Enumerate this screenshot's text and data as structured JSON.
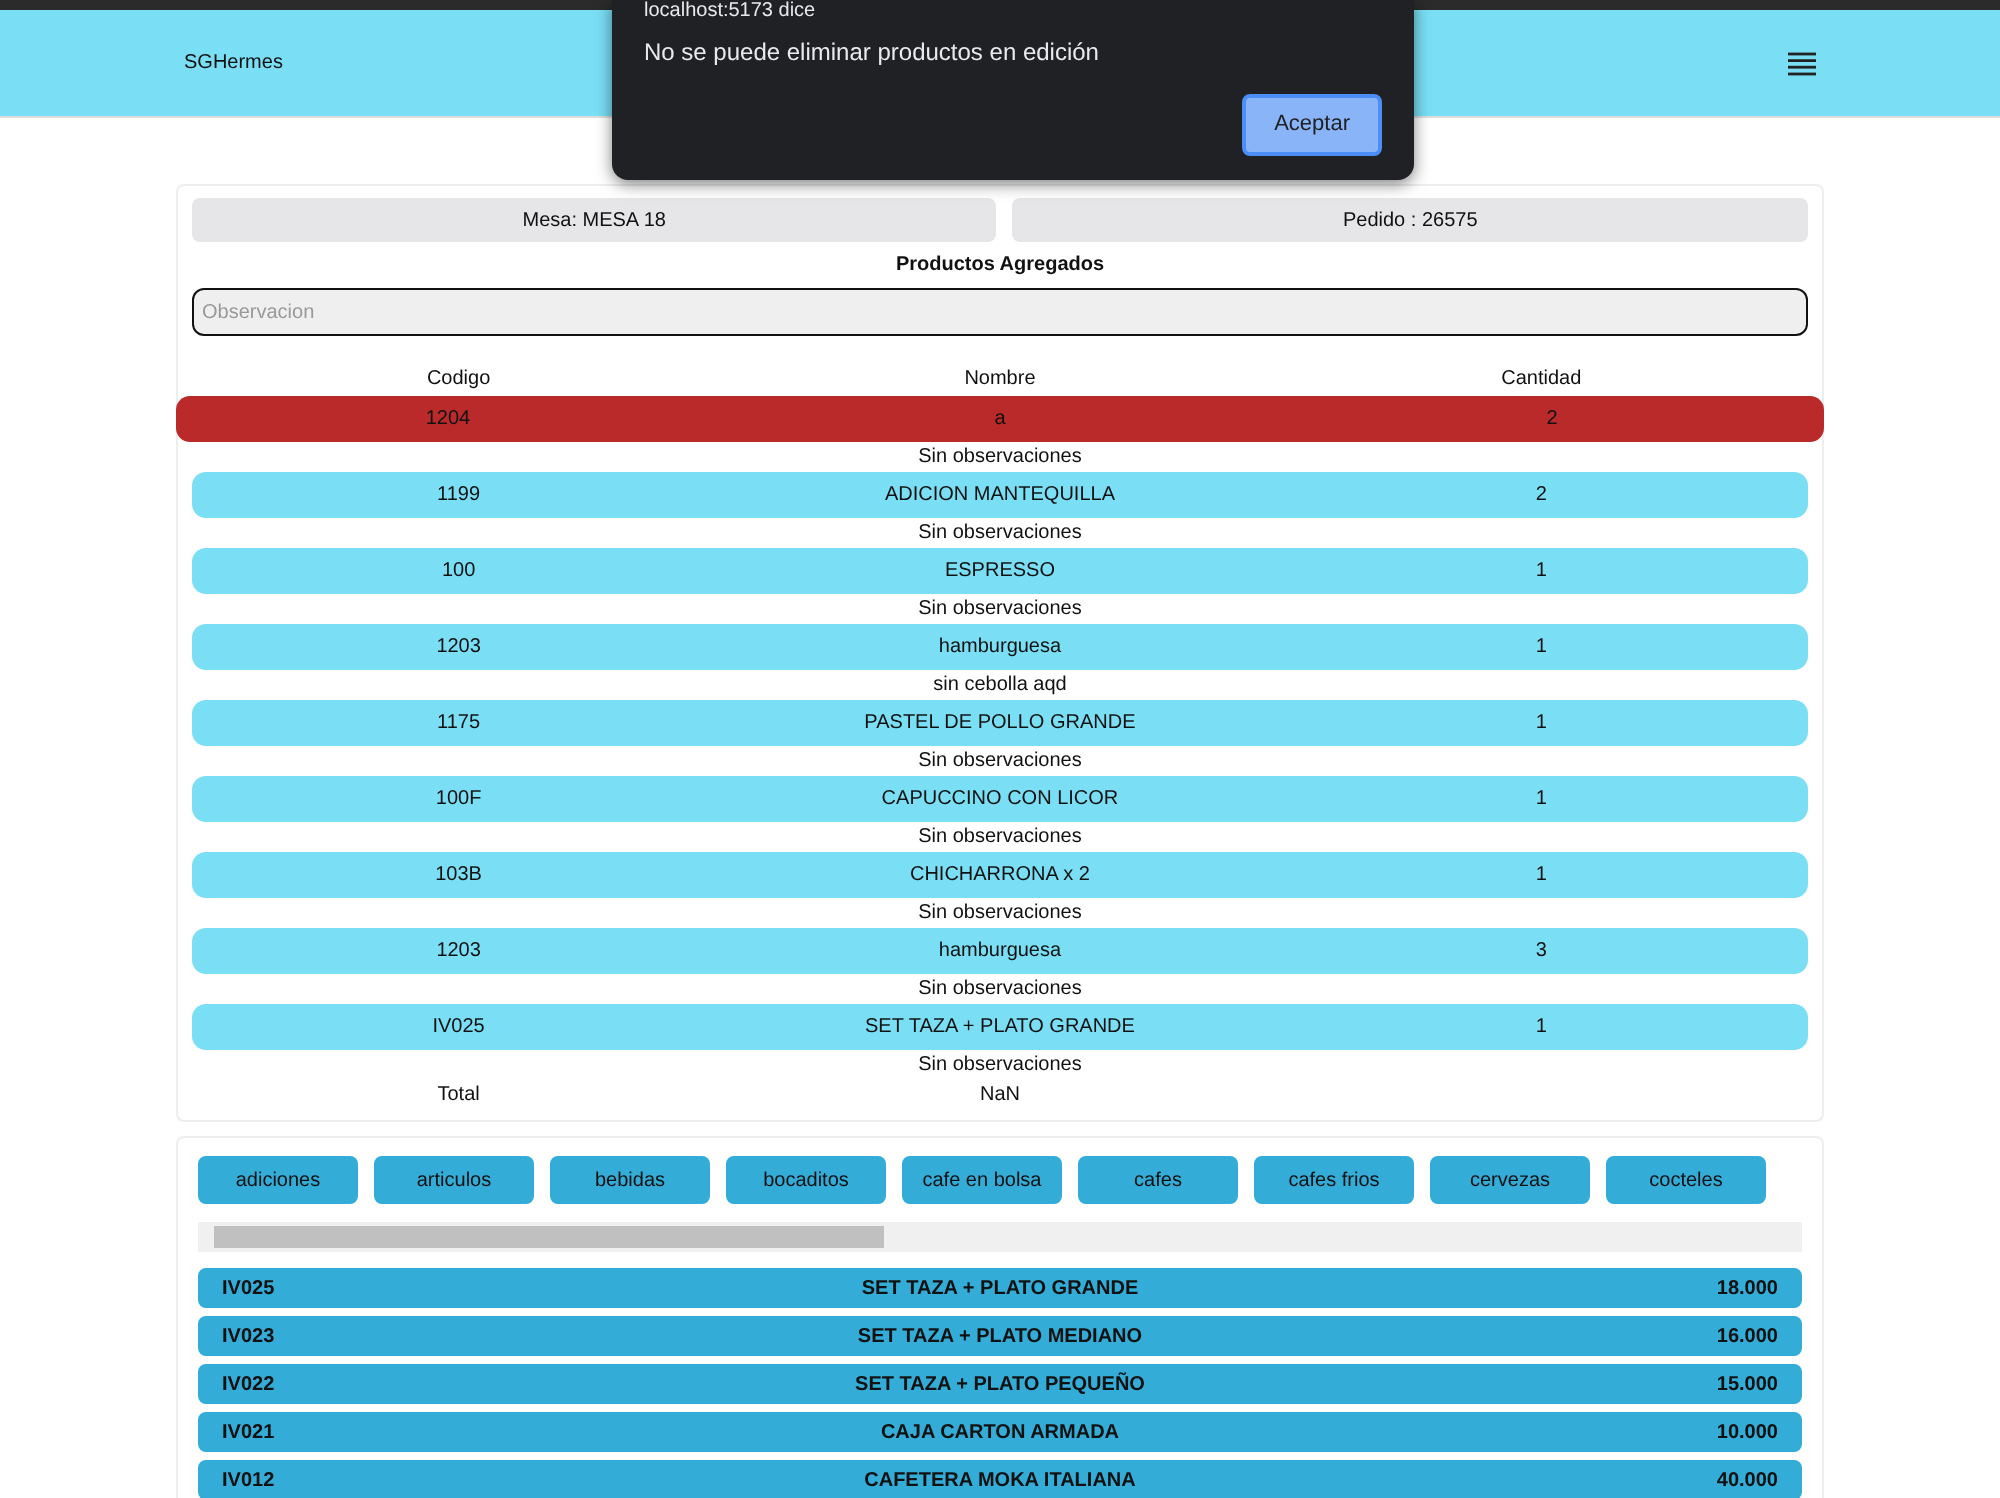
{
  "navbar": {
    "brand": "SGHermes"
  },
  "dialog": {
    "title": "localhost:5173 dice",
    "message": "No se puede eliminar productos en edición",
    "button": "Aceptar"
  },
  "order": {
    "table": "Mesa: MESA 18",
    "order": "Pedido : 26575",
    "heading": "Productos Agregados",
    "observation_placeholder": "Observacion",
    "columns": [
      "Codigo",
      "Nombre",
      "Cantidad"
    ],
    "items": [
      {
        "code": "1204",
        "name": "a",
        "qty": "2",
        "note": "Sin observaciones",
        "selected": true
      },
      {
        "code": "1199",
        "name": "ADICION MANTEQUILLA",
        "qty": "2",
        "note": "Sin observaciones",
        "selected": false
      },
      {
        "code": "100",
        "name": "ESPRESSO",
        "qty": "1",
        "note": "Sin observaciones",
        "selected": false
      },
      {
        "code": "1203",
        "name": "hamburguesa",
        "qty": "1",
        "note": "sin cebolla aqd",
        "selected": false
      },
      {
        "code": "1175",
        "name": "PASTEL DE POLLO GRANDE",
        "qty": "1",
        "note": "Sin observaciones",
        "selected": false
      },
      {
        "code": "100F",
        "name": "CAPUCCINO CON LICOR",
        "qty": "1",
        "note": "Sin observaciones",
        "selected": false
      },
      {
        "code": "103B",
        "name": "CHICHARRONA x 2",
        "qty": "1",
        "note": "Sin observaciones",
        "selected": false
      },
      {
        "code": "1203",
        "name": "hamburguesa",
        "qty": "3",
        "note": "Sin observaciones",
        "selected": false
      },
      {
        "code": "IV025",
        "name": "SET TAZA + PLATO GRANDE",
        "qty": "1",
        "note": "Sin observaciones",
        "selected": false
      }
    ],
    "total_label": "Total",
    "total_value": "NaN"
  },
  "categories": [
    "adiciones",
    "articulos",
    "bebidas",
    "bocaditos",
    "cafe en bolsa",
    "cafes",
    "cafes frios",
    "cervezas",
    "cocteles"
  ],
  "products": [
    {
      "code": "IV025",
      "name": "SET TAZA + PLATO GRANDE",
      "price": "18.000"
    },
    {
      "code": "IV023",
      "name": "SET TAZA + PLATO MEDIANO",
      "price": "16.000"
    },
    {
      "code": "IV022",
      "name": "SET TAZA + PLATO PEQUEÑO",
      "price": "15.000"
    },
    {
      "code": "IV021",
      "name": "CAJA CARTON ARMADA",
      "price": "10.000"
    },
    {
      "code": "IV012",
      "name": "CAFETERA MOKA ITALIANA",
      "price": "40.000"
    }
  ]
}
